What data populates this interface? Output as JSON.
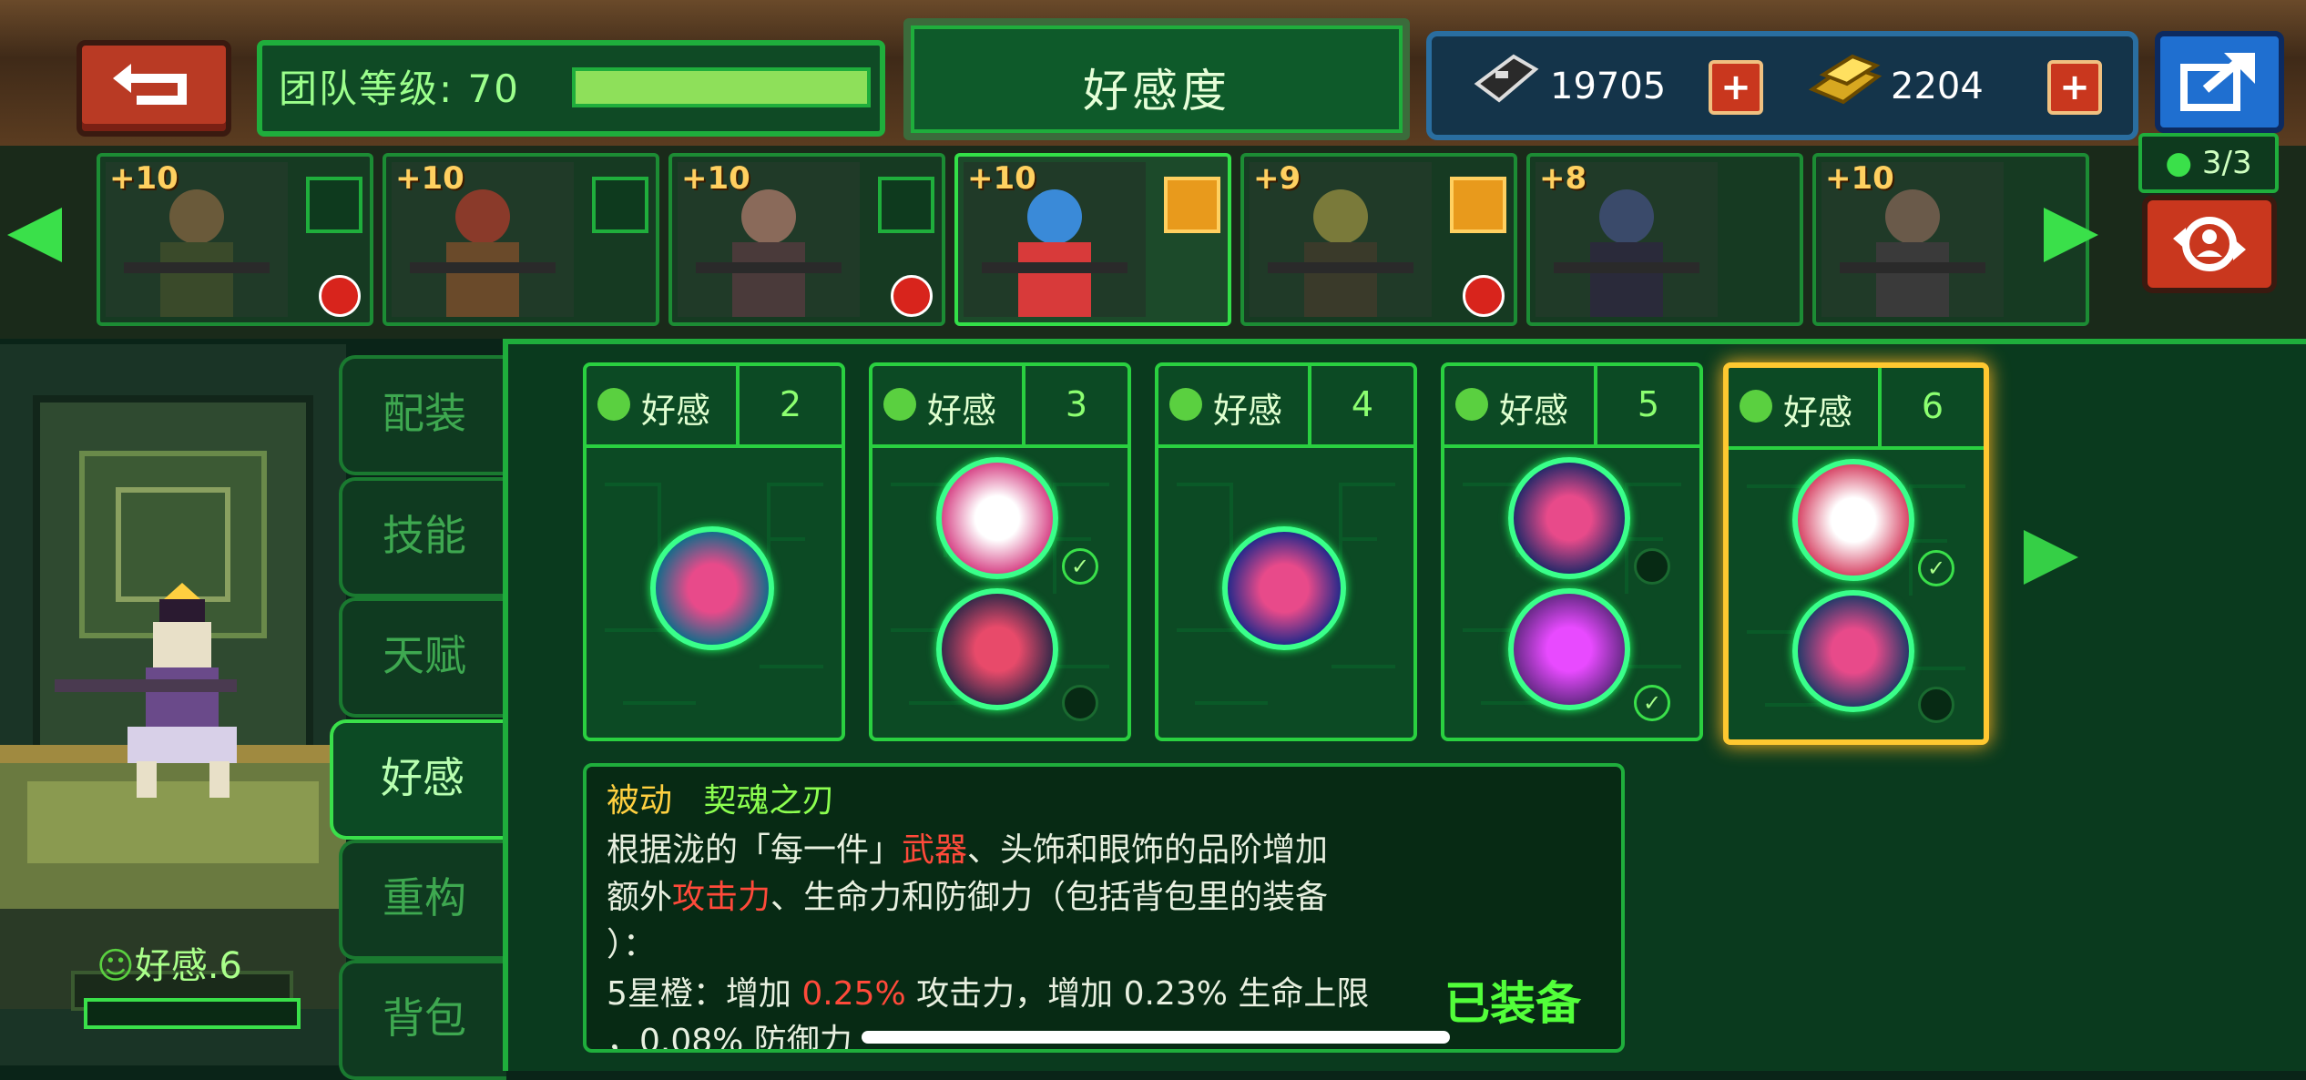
{
  "header": {
    "team_level_label": "团队等级: 70",
    "team_level_progress": 1.0,
    "title": "好感度",
    "resources": [
      {
        "icon": "iron-ingot-icon",
        "amount": "19705"
      },
      {
        "icon": "gold-bar-icon",
        "amount": "2204"
      }
    ],
    "team_count": "3/3"
  },
  "heroes": [
    {
      "level": "+10",
      "tag": "member",
      "badge": "ghost-badge"
    },
    {
      "level": "+10",
      "tag": "member",
      "badge": ""
    },
    {
      "level": "+10",
      "tag": "member",
      "badge": "arms-badge"
    },
    {
      "level": "+10",
      "tag": "equip",
      "badge": "",
      "active": true
    },
    {
      "level": "+9",
      "tag": "equip",
      "badge": "arms-badge"
    },
    {
      "level": "+8",
      "tag": "",
      "badge": ""
    },
    {
      "level": "+10",
      "tag": "",
      "badge": ""
    }
  ],
  "tabs": [
    "配装",
    "技能",
    "天赋",
    "好感",
    "重构",
    "背包"
  ],
  "active_tab": "好感",
  "character": {
    "affinity_label": "好感.6"
  },
  "affinity_cards": [
    {
      "name": "好感",
      "level": "2"
    },
    {
      "name": "好感",
      "level": "3"
    },
    {
      "name": "好感",
      "level": "4"
    },
    {
      "name": "好感",
      "level": "5"
    },
    {
      "name": "好感",
      "level": "6",
      "selected": true
    }
  ],
  "description": {
    "type": "被动",
    "skill_name": "契魂之刃",
    "line1_pre": "根据泷的「每一件」",
    "line1_red": "武器",
    "line1_post": "、头饰和眼饰的品阶增加",
    "line2_pre": "额外",
    "line2_red": "攻击力",
    "line2_post": "、生命力和防御力（包括背包里的装备",
    "line3": "）：",
    "line4_pre": "5星橙：增加 ",
    "line4_red": "0.25%",
    "line4_post": " 攻击力，增加 0.23% 生命上限",
    "line5": "，0.08% 防御力",
    "status": "已装备"
  },
  "colors": {
    "accent": "#1fae3c",
    "highlight": "#ffc830",
    "alert": "#ff4a3a"
  }
}
